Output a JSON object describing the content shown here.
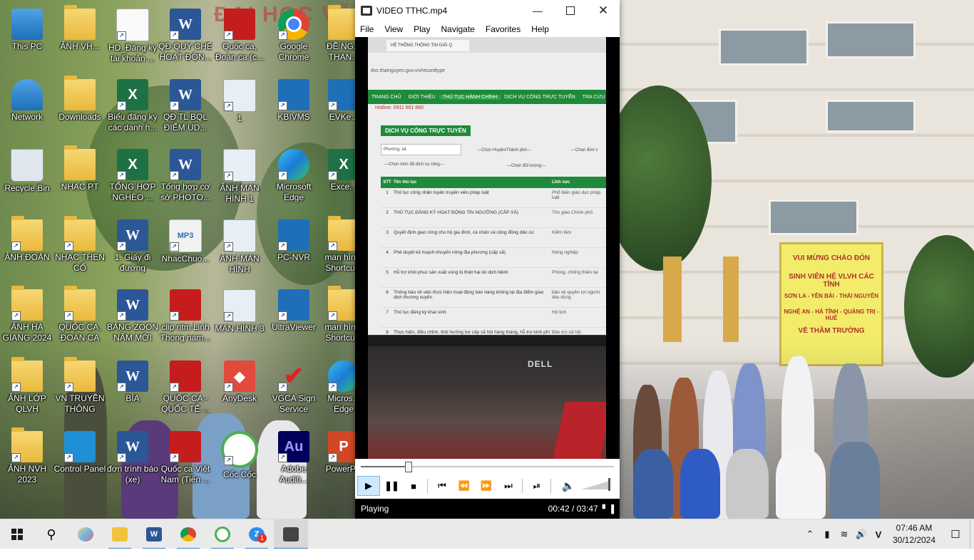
{
  "desktop": {
    "icons": [
      {
        "label": "This PC",
        "icon": "pc-icon"
      },
      {
        "label": "ẢNH VH...",
        "icon": "folder-icon"
      },
      {
        "label": "HD_Đăng ký tài khoản ...",
        "icon": "doc-icon"
      },
      {
        "label": "QĐ QUY CHẾ HOẠT ĐỘN...",
        "icon": "word-icon"
      },
      {
        "label": "Quốc ca, Đoàn ca (c...",
        "icon": "video-icon"
      },
      {
        "label": "Google Chrome",
        "icon": "chrome-icon"
      },
      {
        "label": "ĐỀ NG... THAN...",
        "icon": "folder-icon"
      },
      {
        "label": "Network",
        "icon": "network-icon"
      },
      {
        "label": "Downloads",
        "icon": "folder-icon"
      },
      {
        "label": "Biểu đăng ký các danh h...",
        "icon": "excel-icon"
      },
      {
        "label": "QĐ TL BQL ĐIỂM UD...",
        "icon": "word-icon"
      },
      {
        "label": "1",
        "icon": "screen-icon"
      },
      {
        "label": "KBIVMS",
        "icon": "app-icon"
      },
      {
        "label": "EVKe...",
        "icon": "app-icon"
      },
      {
        "label": "Recycle Bin",
        "icon": "recycle-bin-icon"
      },
      {
        "label": "NHẠC PT",
        "icon": "folder-icon"
      },
      {
        "label": "TỔNG HỢP NGHÈO ...",
        "icon": "excel-icon"
      },
      {
        "label": "Tổng hợp cơ sở PHOTO...",
        "icon": "word-icon"
      },
      {
        "label": "ẢNH MÀN HÌNH 1",
        "icon": "screen-icon"
      },
      {
        "label": "Microsoft Edge",
        "icon": "edge-icon"
      },
      {
        "label": "Exce...",
        "icon": "excel-icon"
      },
      {
        "label": "ẢNH ĐOÀN",
        "icon": "folder-icon"
      },
      {
        "label": "NHẠC THEN CỔ",
        "icon": "folder-icon"
      },
      {
        "label": "1. Giấy đi đường",
        "icon": "word-icon"
      },
      {
        "label": "NhacChuo...",
        "icon": "mp3-icon"
      },
      {
        "label": "ẢNH MÀN HÌNH",
        "icon": "screen-icon"
      },
      {
        "label": "PC-NVR",
        "icon": "app-icon"
      },
      {
        "label": "man hìn... Shortcu...",
        "icon": "folder-icon"
      },
      {
        "label": "ẢNH HÀ GIANG 2024",
        "icon": "folder-icon"
      },
      {
        "label": "QUỐC CA, ĐOÀN CA",
        "icon": "folder-icon"
      },
      {
        "label": "BẢNG ZOON NĂM MỚI",
        "icon": "word-icon"
      },
      {
        "label": "clip ntm Linh Thong nam...",
        "icon": "video-icon"
      },
      {
        "label": "MÀN HÌNH 3",
        "icon": "screen-icon"
      },
      {
        "label": "UltraViewer",
        "icon": "app-icon"
      },
      {
        "label": "man hìn... Shortcu...",
        "icon": "folder-icon"
      },
      {
        "label": "ẢNH LỚP QLVH",
        "icon": "folder-icon"
      },
      {
        "label": "VN TRUYỀN THÔNG",
        "icon": "folder-icon"
      },
      {
        "label": "BÌA",
        "icon": "word-icon"
      },
      {
        "label": "QUỐC CA - QUỐC TẾ ...",
        "icon": "video-icon"
      },
      {
        "label": "AnyDesk",
        "icon": "anydesk-icon"
      },
      {
        "label": "VGCA Sign Service",
        "icon": "vgca-icon"
      },
      {
        "label": "Micros... Edge",
        "icon": "edge-icon"
      },
      {
        "label": "ẢNH NVH 2023",
        "icon": "folder-icon"
      },
      {
        "label": "Control Panel",
        "icon": "control-panel-icon"
      },
      {
        "label": "đơn trình báo (xe)",
        "icon": "word-icon"
      },
      {
        "label": "Quốc ca Việt Nam (Tiến ...",
        "icon": "video-icon"
      },
      {
        "label": "Cốc Cốc",
        "icon": "coccoc-icon"
      },
      {
        "label": "Adobe Auditi...",
        "icon": "adobe-icon"
      },
      {
        "label": "PowerP...",
        "icon": "powerpoint-icon"
      }
    ]
  },
  "wallpaper": {
    "banner": "ĐẠI HỌC VĂ",
    "sign_lines": [
      "VUI MỪNG CHÀO ĐÓN",
      "SINH VIÊN HỆ VLVH CÁC TỈNH",
      "SƠN LA - YÊN BÁI - THÁI NGUYÊN",
      "NGHỆ AN - HÀ TĨNH - QUẢNG TRỊ - HUẾ",
      "VỀ THĂM TRƯỜNG"
    ]
  },
  "player": {
    "title": "VIDEO TTHC.mp4",
    "menu": [
      "File",
      "View",
      "Play",
      "Navigate",
      "Favorites",
      "Help"
    ],
    "status": "Playing",
    "time": "00:42 / 03:47",
    "progress_fraction": 0.185,
    "volume_fraction": 0.95,
    "video": {
      "tab": "HỆ THỐNG THÔNG TIN GIẢI Q",
      "url": "dvc.thainguyen.gov.vn/recordtype",
      "nav": [
        "TRANG CHỦ",
        "GIỚI THIỆU",
        "THỦ TỤC HÀNH CHÍNH",
        "DỊCH VỤ CÔNG TRỰC TUYẾN",
        "TRA CỨU HỒ SƠ"
      ],
      "hotline": "Hotline: 0911 661 880",
      "heading": "DỊCH VỤ CÔNG TRỰC TUYẾN",
      "selects": [
        "Phường, xã",
        "---Chọn Huyện/Thành phố---",
        "---Chọn đơn v",
        "---Chọn mức độ dịch vụ công---",
        "---Chọn đối tượng---"
      ],
      "columns": [
        "STT",
        "Tên thủ tục",
        "Lĩnh vực"
      ],
      "rows": [
        {
          "stt": "1",
          "name": "Thủ tục công nhận tuyên truyền viên pháp luật",
          "field": "Phổ biến giáo dục pháp luật"
        },
        {
          "stt": "2",
          "name": "THỦ TỤC ĐĂNG KÝ HOẠT ĐỘNG TÍN NGƯỠNG (CẤP XÃ)",
          "field": "Tôn giáo Chính phủ"
        },
        {
          "stt": "3",
          "name": "Quyết định giao rừng cho hộ gia đình, cá nhân và cộng đồng dân cư",
          "field": "Kiểm lâm"
        },
        {
          "stt": "4",
          "name": "Phê duyệt kế hoạch khuyến nông địa phương (cấp xã)",
          "field": "Nông nghiệp"
        },
        {
          "stt": "5",
          "name": "Hỗ trợ khôi phục sản xuất vùng bị thiệt hại do dịch bệnh",
          "field": "Phòng, chống thiên tai"
        },
        {
          "stt": "6",
          "name": "Thông báo về việc thực hiện hoạt động bán hàng không tại địa điểm giao dịch thường xuyên",
          "field": "bảo vệ quyền lợi người tiêu dùng"
        },
        {
          "stt": "7",
          "name": "Thủ tục đăng ký khai sinh",
          "field": "Hộ tịch"
        },
        {
          "stt": "8",
          "name": "Thực hiện, điều chỉnh, thôi hưởng trợ cấp xã hội hàng tháng, hỗ trợ kinh phí chăm sóc, nuôi dưỡng hàng tháng",
          "field": "Bảo trợ xã hội"
        }
      ],
      "brand": "DELL"
    }
  },
  "taskbar": {
    "apps": [
      "start-icon",
      "search-icon",
      "paint-icon",
      "file-explorer-icon",
      "word-icon",
      "chrome-icon",
      "coccoc-icon",
      "zalo-icon",
      "media-player-icon"
    ],
    "zalo_badge": "1",
    "word_letter": "W",
    "clock_time": "07:46 AM",
    "clock_date": "30/12/2024"
  },
  "colors": {
    "accent": "#3d7fd1",
    "portal_green": "#1f8a3a",
    "status_bar": "#000000"
  }
}
